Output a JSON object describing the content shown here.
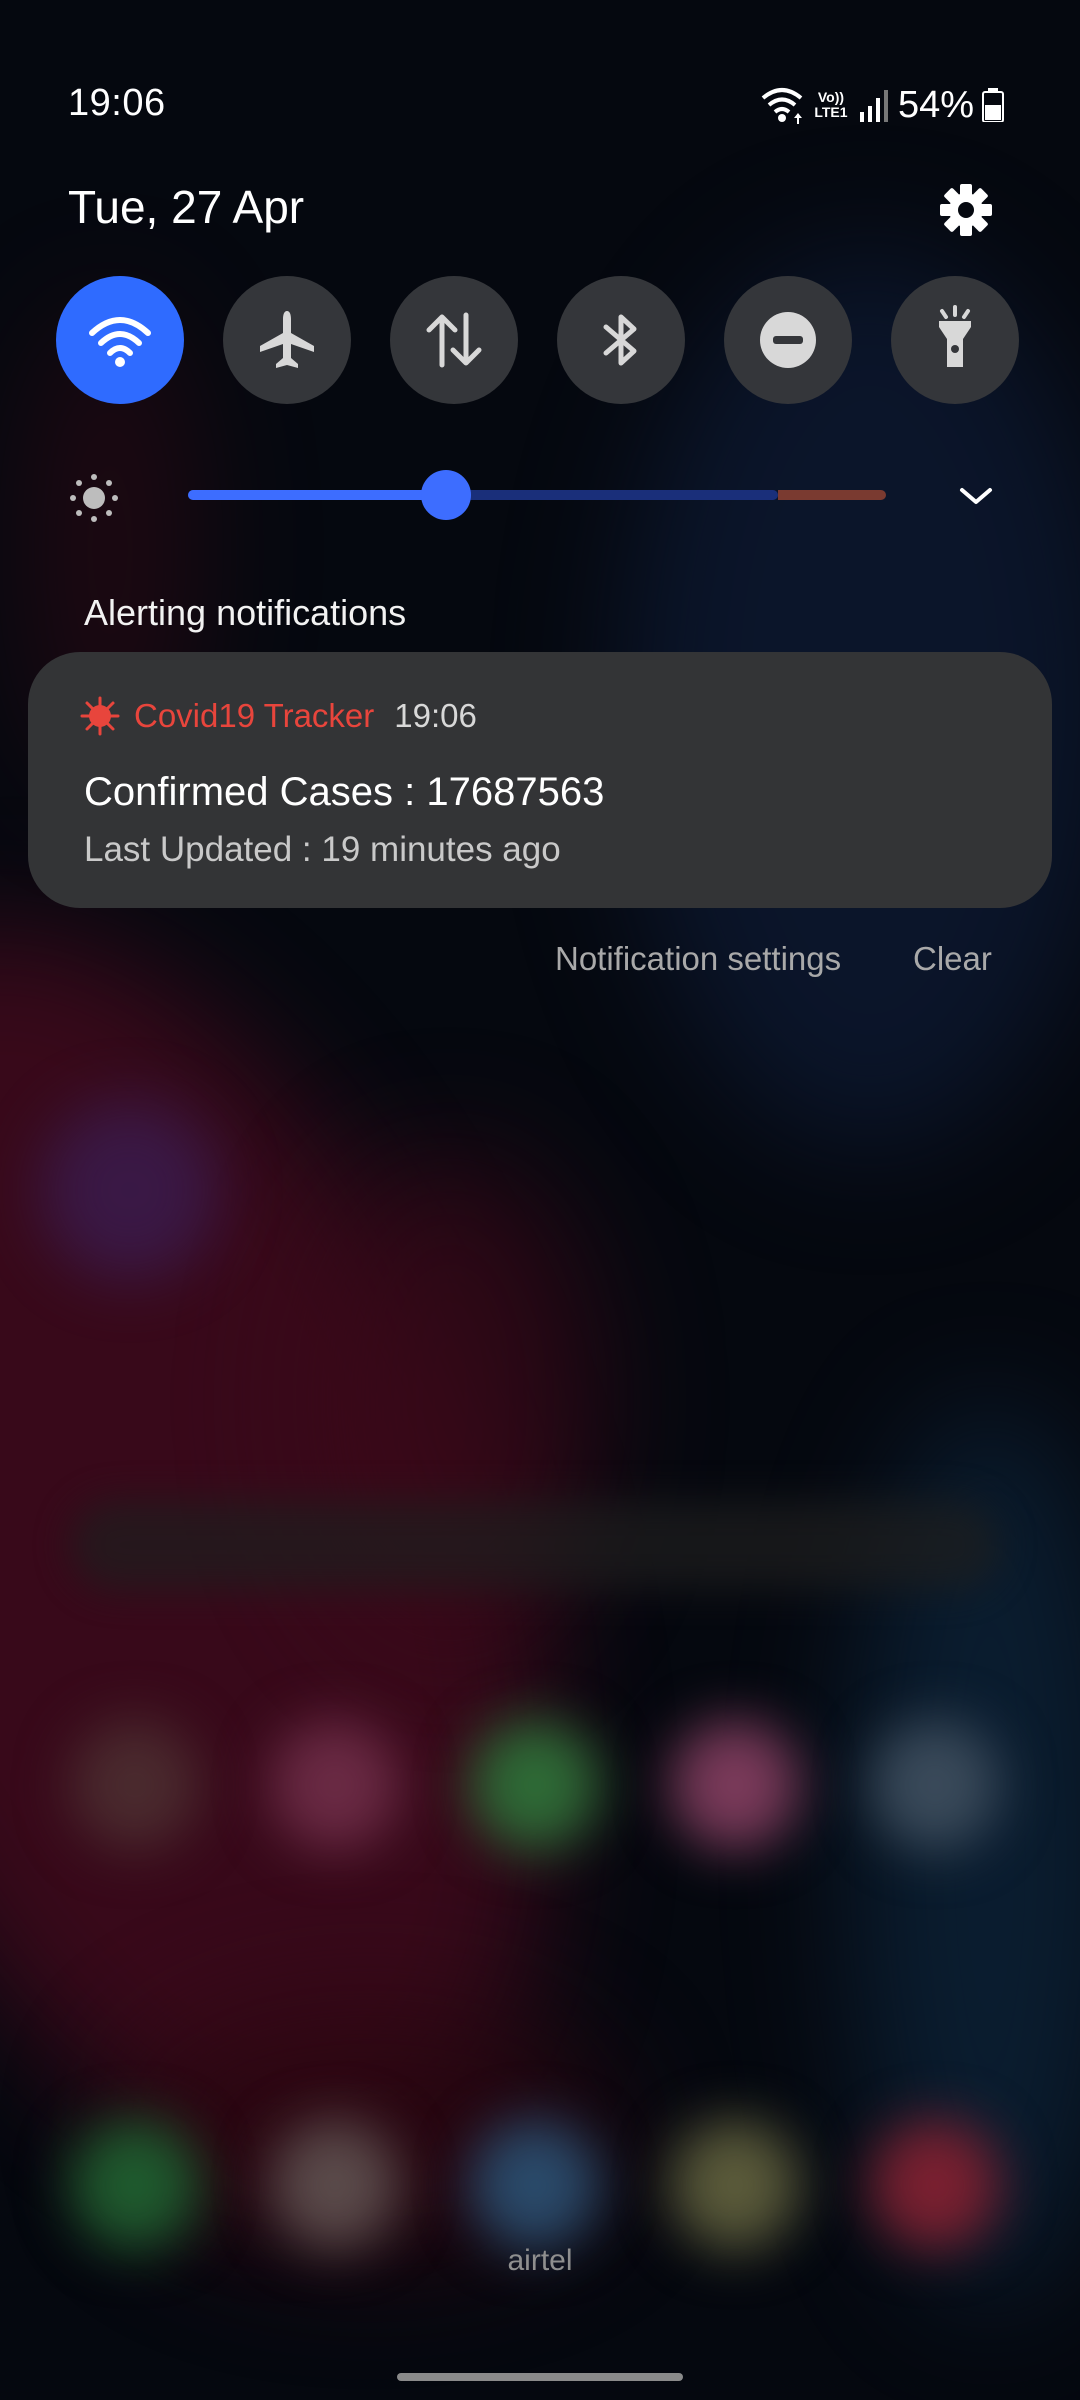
{
  "status_bar": {
    "time": "19:06",
    "network_label": "Vo)) LTE1",
    "battery": "54%"
  },
  "header": {
    "date": "Tue, 27 Apr"
  },
  "quick_settings": {
    "tiles": [
      {
        "name": "wifi",
        "icon": "wifi-icon",
        "active": true
      },
      {
        "name": "airplane-mode",
        "icon": "airplane-icon",
        "active": false
      },
      {
        "name": "mobile-data",
        "icon": "data-arrows-icon",
        "active": false
      },
      {
        "name": "bluetooth",
        "icon": "bluetooth-icon",
        "active": false
      },
      {
        "name": "do-not-disturb",
        "icon": "dnd-icon",
        "active": false
      },
      {
        "name": "flashlight",
        "icon": "flashlight-icon",
        "active": false
      }
    ],
    "brightness_level": 0.37
  },
  "notifications": {
    "section_title": "Alerting notifications",
    "items": [
      {
        "app_name": "Covid19 Tracker",
        "time": "19:06",
        "title": "Confirmed Cases : 17687563",
        "text": "Last Updated : 19 minutes ago",
        "app_color": "#e8453c",
        "icon": "virus-icon"
      }
    ],
    "settings_label": "Notification settings",
    "clear_label": "Clear"
  },
  "carrier": "airtel",
  "colors": {
    "accent": "#2f6bff",
    "tile_bg": "#34363a",
    "card_bg": "#333436"
  }
}
